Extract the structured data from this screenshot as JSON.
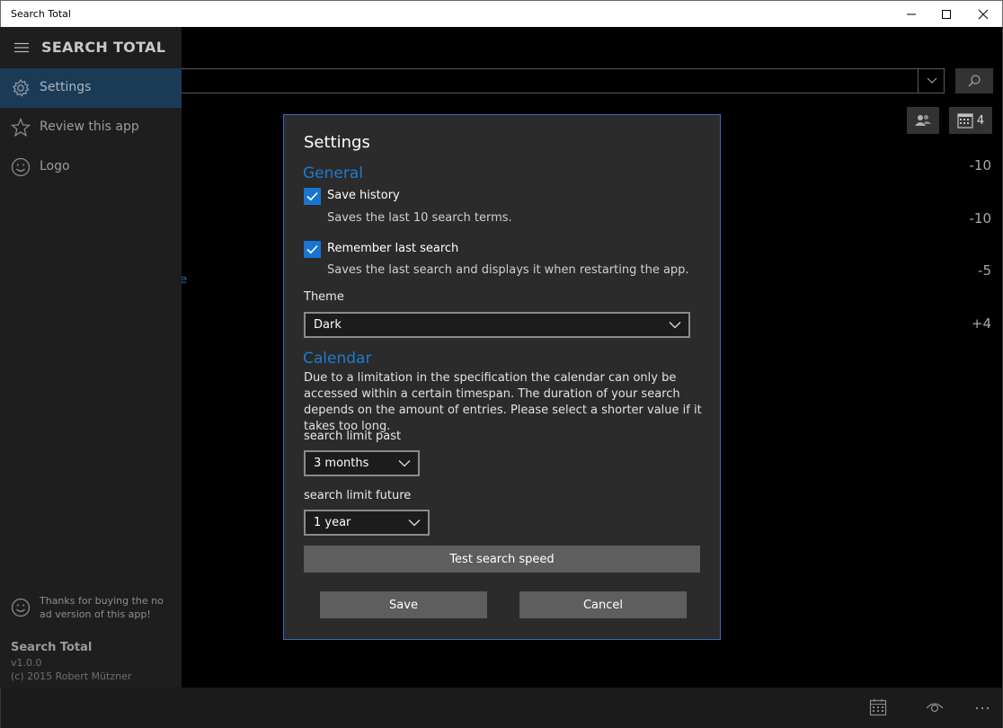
{
  "window": {
    "title": "Search Total"
  },
  "sidebar": {
    "brand": "SEARCH TOTAL",
    "items": [
      {
        "label": "Settings",
        "icon": "gear-icon",
        "active": true
      },
      {
        "label": "Review this app",
        "icon": "star-icon",
        "active": false
      },
      {
        "label": "Logo",
        "icon": "smiley-icon",
        "active": false
      }
    ],
    "thanks": "Thanks for buying the no ad version of this app!",
    "app_name": "Search Total",
    "version": "v1.0.0",
    "copyright": "(c) 2015 Robert Mützner"
  },
  "main": {
    "search_value": "",
    "calendar_count": "4",
    "counts": [
      "-10",
      "-10",
      "-5",
      "+4"
    ],
    "stray_text": "e"
  },
  "dialog": {
    "title": "Settings",
    "general_heading": "General",
    "save_history": {
      "label": "Save history",
      "checked": true,
      "hint": "Saves the last 10 search terms."
    },
    "remember_search": {
      "label": "Remember last search",
      "checked": true,
      "hint": "Saves the last search and displays it when restarting the app."
    },
    "theme_label": "Theme",
    "theme_value": "Dark",
    "calendar_heading": "Calendar",
    "calendar_text": "Due to a limitation in the specification the calendar can only be accessed within a certain timespan. The duration of your search depends on the amount of entries. Please select a shorter value if it takes too long.",
    "past_label": "search limit past",
    "past_value": "3 months",
    "future_label": "search limit future",
    "future_value": "1 year",
    "test_button": "Test search speed",
    "save_button": "Save",
    "cancel_button": "Cancel"
  },
  "colors": {
    "accent": "#1f7bd0",
    "dialog_border": "#2f6fb8",
    "sidebar_active": "#1b3a56"
  }
}
